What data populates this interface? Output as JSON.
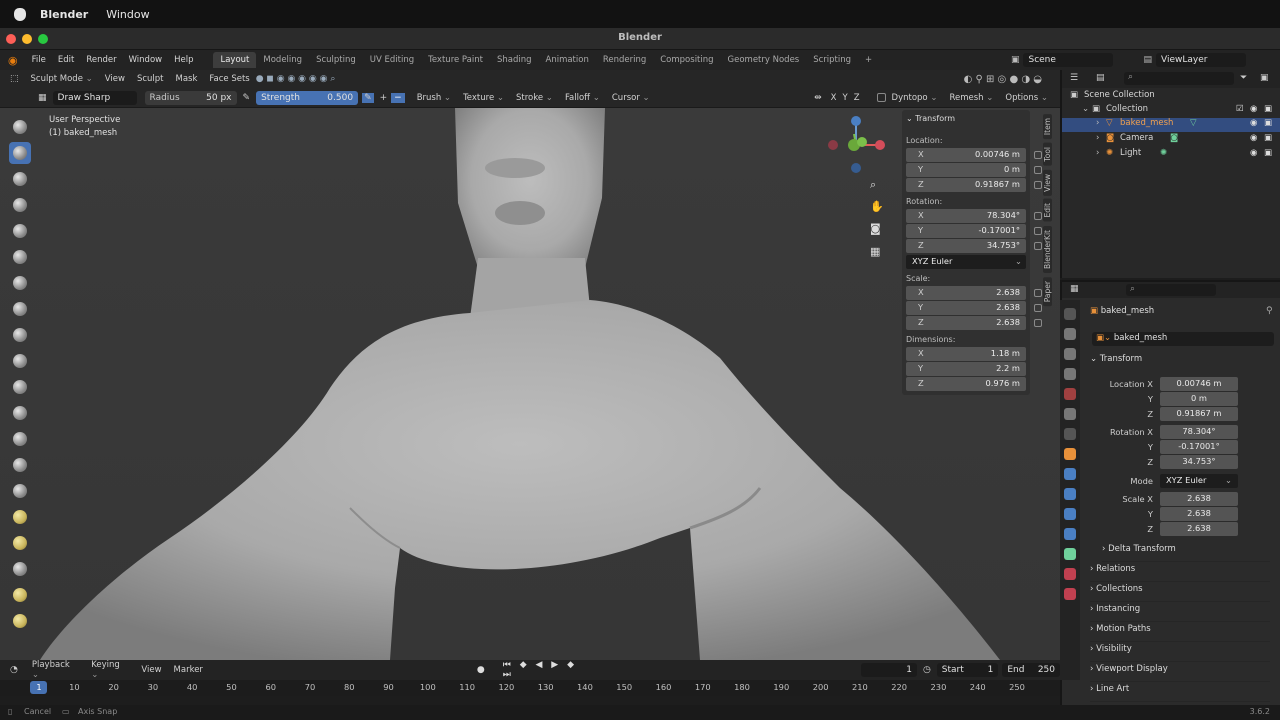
{
  "mac": {
    "app": "Blender",
    "menu": "Window"
  },
  "title": "Blender",
  "menus": [
    "File",
    "Edit",
    "Render",
    "Window",
    "Help"
  ],
  "workspaces": [
    "Layout",
    "Modeling",
    "Sculpting",
    "UV Editing",
    "Texture Paint",
    "Shading",
    "Animation",
    "Rendering",
    "Compositing",
    "Geometry Nodes",
    "Scripting"
  ],
  "scene": "Scene",
  "viewlayer": "ViewLayer",
  "header1": {
    "mode": "Sculpt Mode",
    "items": [
      "View",
      "Sculpt",
      "Mask",
      "Face Sets"
    ]
  },
  "header2": {
    "brush": "Draw Sharp",
    "radius_label": "Radius",
    "radius": "50 px",
    "strength_label": "Strength",
    "strength": "0.500",
    "menus": [
      "Brush",
      "Texture",
      "Stroke",
      "Falloff",
      "Cursor"
    ],
    "axes": [
      "X",
      "Y",
      "Z"
    ],
    "dyntopo": "Dyntopo",
    "remesh": "Remesh",
    "options": "Options"
  },
  "viewport": {
    "line1": "User Perspective",
    "line2": "(1) baked_mesh"
  },
  "npanel": {
    "title": "Transform",
    "location": "Location:",
    "rotation": "Rotation:",
    "scale": "Scale:",
    "dimensions": "Dimensions:",
    "mode": "XYZ Euler",
    "loc": [
      [
        "X",
        "0.00746 m"
      ],
      [
        "Y",
        "0 m"
      ],
      [
        "Z",
        "0.91867 m"
      ]
    ],
    "rot": [
      [
        "X",
        "78.304°"
      ],
      [
        "Y",
        "-0.17001°"
      ],
      [
        "Z",
        "34.753°"
      ]
    ],
    "scl": [
      [
        "X",
        "2.638"
      ],
      [
        "Y",
        "2.638"
      ],
      [
        "Z",
        "2.638"
      ]
    ],
    "dim": [
      [
        "X",
        "1.18 m"
      ],
      [
        "Y",
        "2.2 m"
      ],
      [
        "Z",
        "0.976 m"
      ]
    ]
  },
  "sidetabs": [
    "Item",
    "Tool",
    "View",
    "Edit",
    "BlenderKit",
    "Paper"
  ],
  "outliner": {
    "root": "Scene Collection",
    "collection": "Collection",
    "items": [
      "baked_mesh",
      "Camera",
      "Light"
    ]
  },
  "props": {
    "object": "baked_mesh",
    "data": "baked_mesh",
    "transform": "Transform",
    "location_x": "Location X",
    "rotation_x": "Rotation X",
    "mode_label": "Mode",
    "scale_x": "Scale X",
    "y": "Y",
    "z": "Z",
    "sections": [
      "Delta Transform",
      "Relations",
      "Collections",
      "Instancing",
      "Motion Paths",
      "Visibility",
      "Viewport Display",
      "Line Art"
    ]
  },
  "timeline": {
    "items": [
      "Playback",
      "Keying",
      "View",
      "Marker"
    ],
    "frame": "1",
    "start_label": "Start",
    "start": "1",
    "end_label": "End",
    "end": "250"
  },
  "ruler": [
    "1",
    "10",
    "20",
    "30",
    "40",
    "50",
    "60",
    "70",
    "80",
    "90",
    "100",
    "110",
    "120",
    "130",
    "140",
    "150",
    "160",
    "170",
    "180",
    "190",
    "200",
    "210",
    "220",
    "230",
    "240",
    "250"
  ],
  "status": {
    "cancel": "Cancel",
    "axis": "Axis Snap",
    "version": "3.6.2"
  }
}
